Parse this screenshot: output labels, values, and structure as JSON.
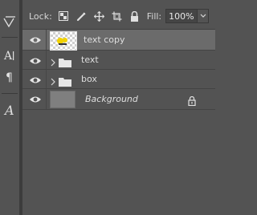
{
  "lockbar": {
    "lock_label": "Lock:",
    "fill_label": "Fill:",
    "fill_value": "100%"
  },
  "toolbar": {
    "tools": [
      "path-text-tool-icon",
      "character-panel-icon",
      "paragraph-panel-icon",
      "glyphs-panel-icon"
    ]
  },
  "layers": [
    {
      "name": "text copy",
      "type": "smart-object",
      "selected": true
    },
    {
      "name": "text",
      "type": "group"
    },
    {
      "name": "box",
      "type": "group"
    },
    {
      "name": "Background",
      "type": "background",
      "locked": true
    }
  ],
  "colors": {
    "panel_bg": "#535353",
    "selected_row": "#6b6b6b"
  }
}
